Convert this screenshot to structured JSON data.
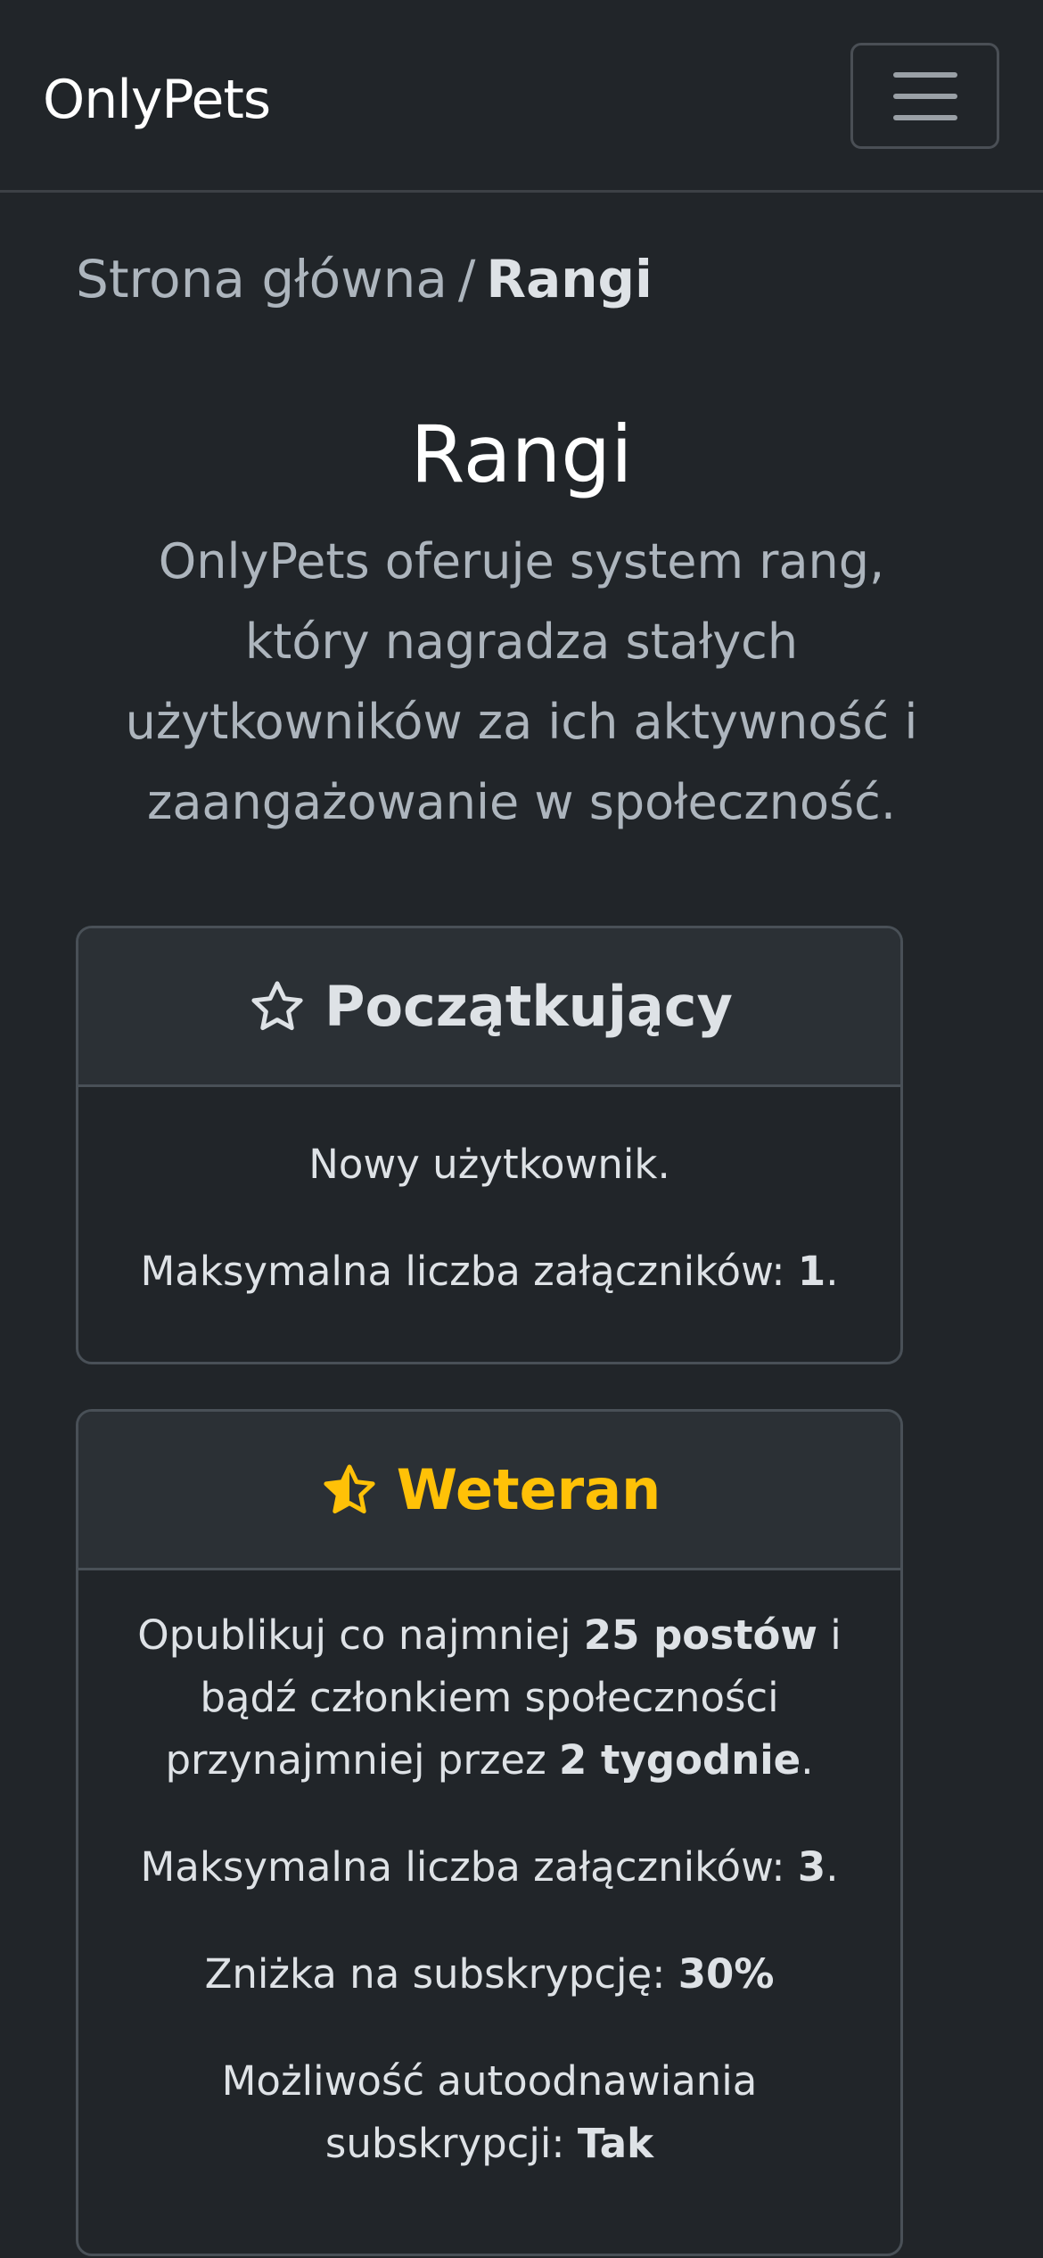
{
  "navbar": {
    "brand": "OnlyPets",
    "menu_icon": "hamburger-menu-icon"
  },
  "breadcrumb": {
    "home": "Strona główna",
    "separator": "/",
    "current": "Rangi"
  },
  "page": {
    "title": "Rangi",
    "lead": "OnlyPets oferuje system rang, który nagradza stałych użytkowników za ich aktywność i zaangażowanie w społeczność."
  },
  "ranks": [
    {
      "name": "Początkujący",
      "icon": "star-outline-icon",
      "color": "#dee2e6",
      "description": "Nowy użytkownik.",
      "attachments_label": "Maksymalna liczba załączników: ",
      "attachments_value": "1",
      "attachments_suffix": "."
    },
    {
      "name": "Weteran",
      "icon": "star-half-icon",
      "color": "#ffc107",
      "req_prefix": "Opublikuj co najmniej ",
      "req_posts": "25 postów",
      "req_middle": " i bądź członkiem społeczności przynajmniej przez ",
      "req_time": "2 tygodnie",
      "req_suffix": ".",
      "attachments_label": "Maksymalna liczba załączników: ",
      "attachments_value": "3",
      "attachments_suffix": ".",
      "discount_label": "Zniżka na subskrypcję: ",
      "discount_value": "30%",
      "autorenew_label": "Możliwość autoodnawiania subskrypcji: ",
      "autorenew_value": "Tak"
    }
  ]
}
